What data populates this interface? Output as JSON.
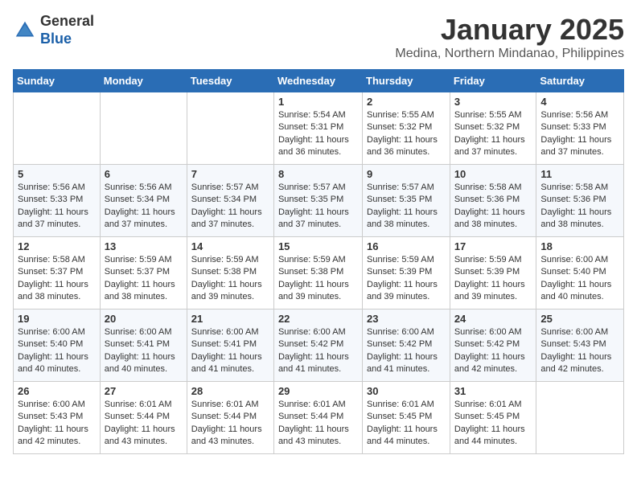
{
  "logo": {
    "general": "General",
    "blue": "Blue"
  },
  "title": "January 2025",
  "location": "Medina, Northern Mindanao, Philippines",
  "days_of_week": [
    "Sunday",
    "Monday",
    "Tuesday",
    "Wednesday",
    "Thursday",
    "Friday",
    "Saturday"
  ],
  "weeks": [
    [
      {
        "day": "",
        "content": ""
      },
      {
        "day": "",
        "content": ""
      },
      {
        "day": "",
        "content": ""
      },
      {
        "day": "1",
        "content": "Sunrise: 5:54 AM\nSunset: 5:31 PM\nDaylight: 11 hours and 36 minutes."
      },
      {
        "day": "2",
        "content": "Sunrise: 5:55 AM\nSunset: 5:32 PM\nDaylight: 11 hours and 36 minutes."
      },
      {
        "day": "3",
        "content": "Sunrise: 5:55 AM\nSunset: 5:32 PM\nDaylight: 11 hours and 37 minutes."
      },
      {
        "day": "4",
        "content": "Sunrise: 5:56 AM\nSunset: 5:33 PM\nDaylight: 11 hours and 37 minutes."
      }
    ],
    [
      {
        "day": "5",
        "content": "Sunrise: 5:56 AM\nSunset: 5:33 PM\nDaylight: 11 hours and 37 minutes."
      },
      {
        "day": "6",
        "content": "Sunrise: 5:56 AM\nSunset: 5:34 PM\nDaylight: 11 hours and 37 minutes."
      },
      {
        "day": "7",
        "content": "Sunrise: 5:57 AM\nSunset: 5:34 PM\nDaylight: 11 hours and 37 minutes."
      },
      {
        "day": "8",
        "content": "Sunrise: 5:57 AM\nSunset: 5:35 PM\nDaylight: 11 hours and 37 minutes."
      },
      {
        "day": "9",
        "content": "Sunrise: 5:57 AM\nSunset: 5:35 PM\nDaylight: 11 hours and 38 minutes."
      },
      {
        "day": "10",
        "content": "Sunrise: 5:58 AM\nSunset: 5:36 PM\nDaylight: 11 hours and 38 minutes."
      },
      {
        "day": "11",
        "content": "Sunrise: 5:58 AM\nSunset: 5:36 PM\nDaylight: 11 hours and 38 minutes."
      }
    ],
    [
      {
        "day": "12",
        "content": "Sunrise: 5:58 AM\nSunset: 5:37 PM\nDaylight: 11 hours and 38 minutes."
      },
      {
        "day": "13",
        "content": "Sunrise: 5:59 AM\nSunset: 5:37 PM\nDaylight: 11 hours and 38 minutes."
      },
      {
        "day": "14",
        "content": "Sunrise: 5:59 AM\nSunset: 5:38 PM\nDaylight: 11 hours and 39 minutes."
      },
      {
        "day": "15",
        "content": "Sunrise: 5:59 AM\nSunset: 5:38 PM\nDaylight: 11 hours and 39 minutes."
      },
      {
        "day": "16",
        "content": "Sunrise: 5:59 AM\nSunset: 5:39 PM\nDaylight: 11 hours and 39 minutes."
      },
      {
        "day": "17",
        "content": "Sunrise: 5:59 AM\nSunset: 5:39 PM\nDaylight: 11 hours and 39 minutes."
      },
      {
        "day": "18",
        "content": "Sunrise: 6:00 AM\nSunset: 5:40 PM\nDaylight: 11 hours and 40 minutes."
      }
    ],
    [
      {
        "day": "19",
        "content": "Sunrise: 6:00 AM\nSunset: 5:40 PM\nDaylight: 11 hours and 40 minutes."
      },
      {
        "day": "20",
        "content": "Sunrise: 6:00 AM\nSunset: 5:41 PM\nDaylight: 11 hours and 40 minutes."
      },
      {
        "day": "21",
        "content": "Sunrise: 6:00 AM\nSunset: 5:41 PM\nDaylight: 11 hours and 41 minutes."
      },
      {
        "day": "22",
        "content": "Sunrise: 6:00 AM\nSunset: 5:42 PM\nDaylight: 11 hours and 41 minutes."
      },
      {
        "day": "23",
        "content": "Sunrise: 6:00 AM\nSunset: 5:42 PM\nDaylight: 11 hours and 41 minutes."
      },
      {
        "day": "24",
        "content": "Sunrise: 6:00 AM\nSunset: 5:42 PM\nDaylight: 11 hours and 42 minutes."
      },
      {
        "day": "25",
        "content": "Sunrise: 6:00 AM\nSunset: 5:43 PM\nDaylight: 11 hours and 42 minutes."
      }
    ],
    [
      {
        "day": "26",
        "content": "Sunrise: 6:00 AM\nSunset: 5:43 PM\nDaylight: 11 hours and 42 minutes."
      },
      {
        "day": "27",
        "content": "Sunrise: 6:01 AM\nSunset: 5:44 PM\nDaylight: 11 hours and 43 minutes."
      },
      {
        "day": "28",
        "content": "Sunrise: 6:01 AM\nSunset: 5:44 PM\nDaylight: 11 hours and 43 minutes."
      },
      {
        "day": "29",
        "content": "Sunrise: 6:01 AM\nSunset: 5:44 PM\nDaylight: 11 hours and 43 minutes."
      },
      {
        "day": "30",
        "content": "Sunrise: 6:01 AM\nSunset: 5:45 PM\nDaylight: 11 hours and 44 minutes."
      },
      {
        "day": "31",
        "content": "Sunrise: 6:01 AM\nSunset: 5:45 PM\nDaylight: 11 hours and 44 minutes."
      },
      {
        "day": "",
        "content": ""
      }
    ]
  ]
}
